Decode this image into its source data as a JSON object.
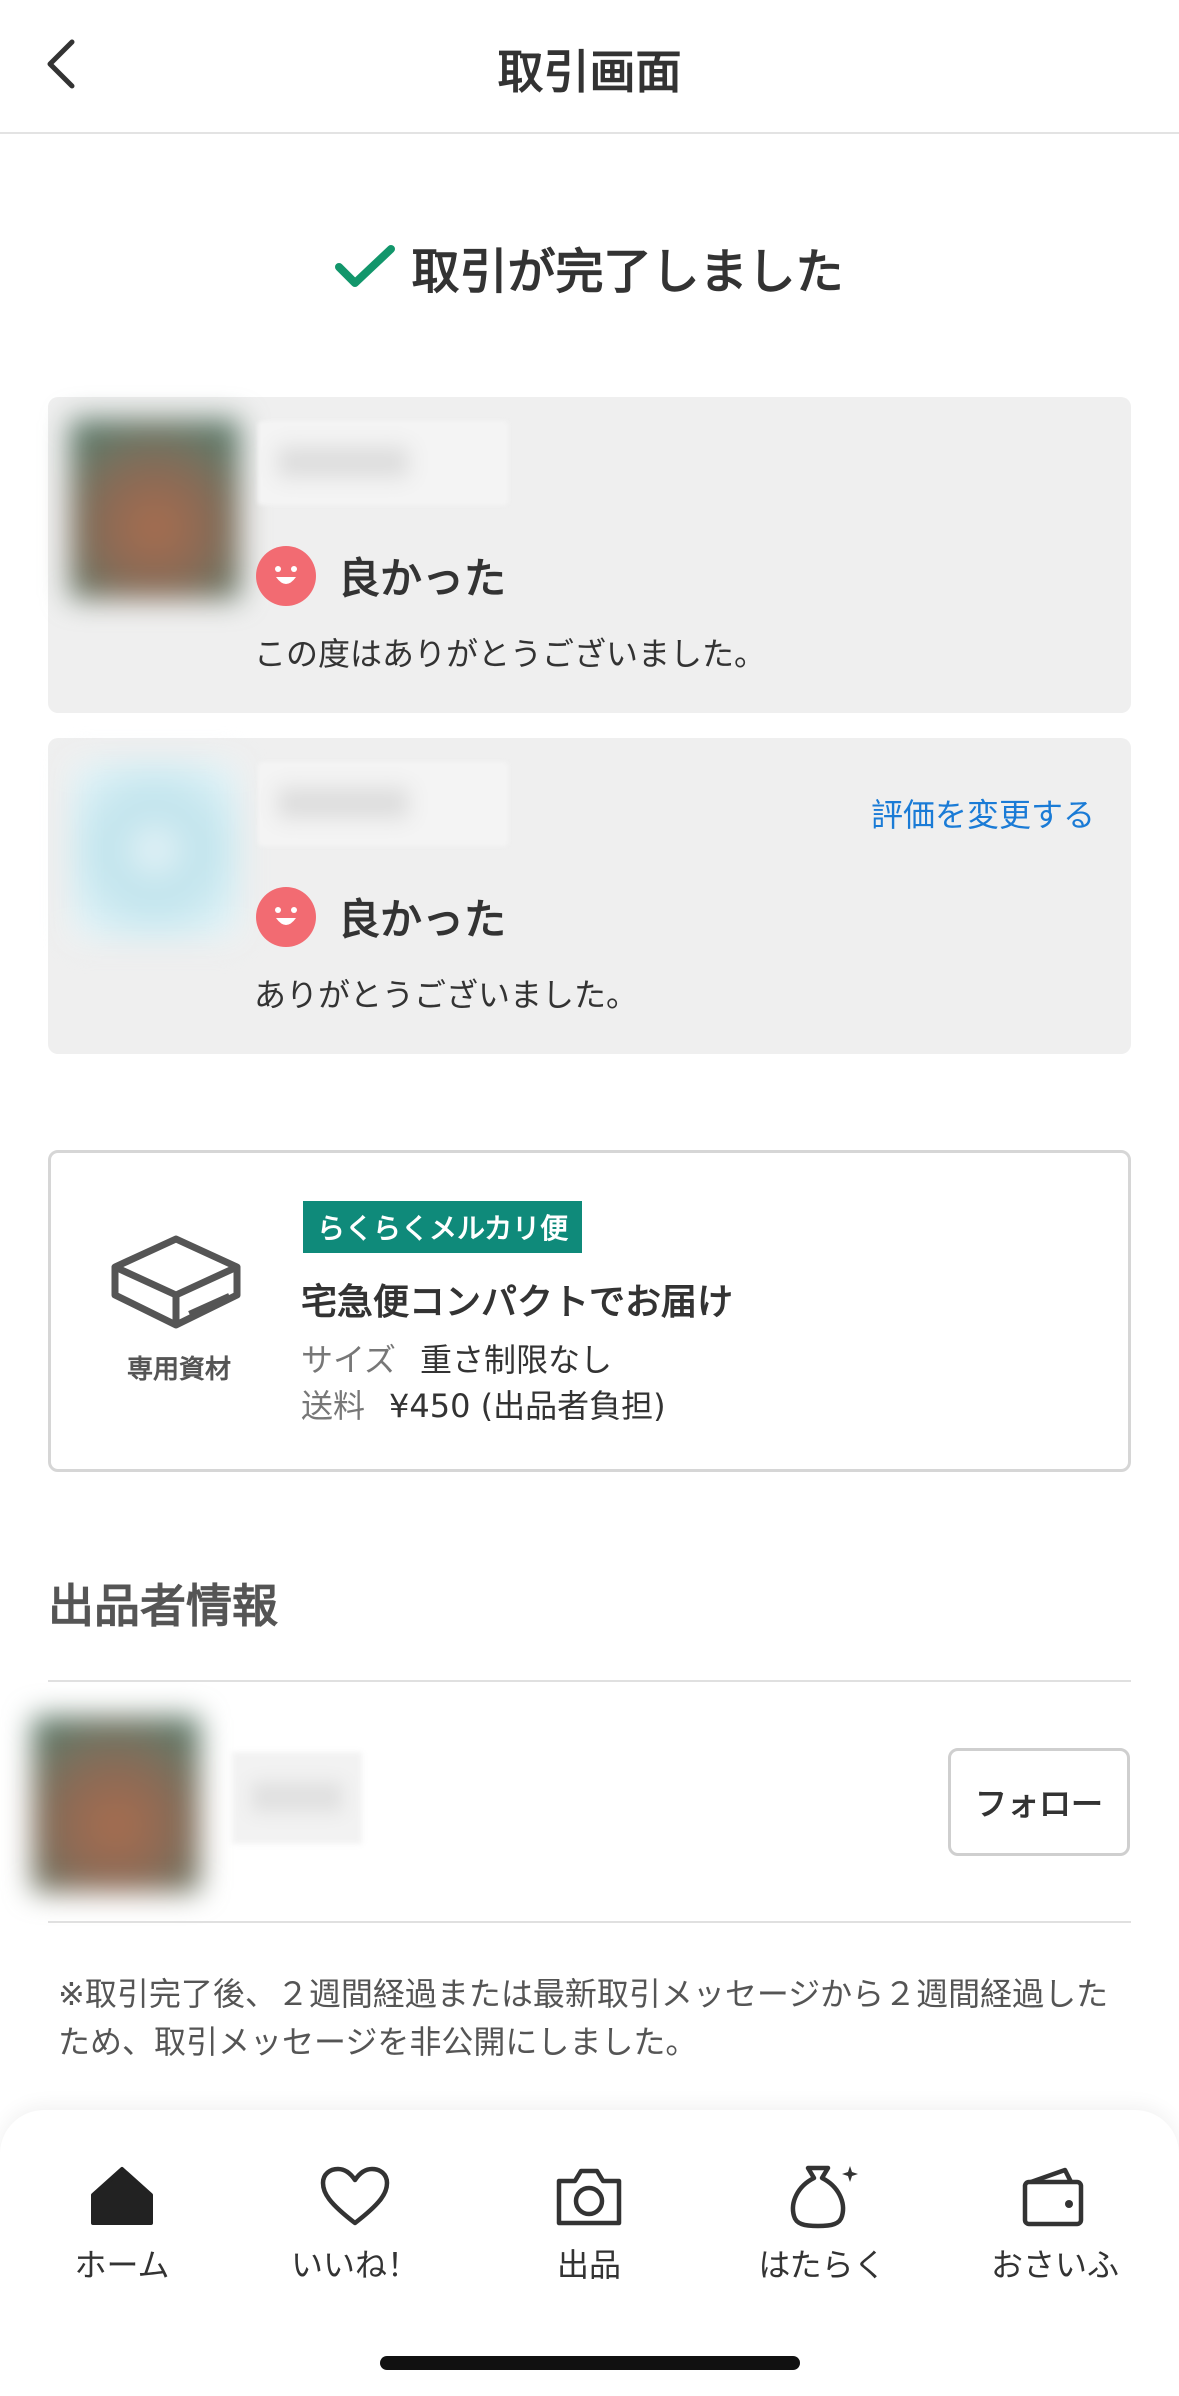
{
  "header": {
    "title": "取引画面"
  },
  "status": {
    "completed_text": "取引が完了しました"
  },
  "reviews": [
    {
      "rating_label": "良かった",
      "comment": "この度はありがとうございました。"
    },
    {
      "rating_label": "良かった",
      "comment": "ありがとうございました。",
      "change_link": "評価を変更する"
    }
  ],
  "shipping": {
    "box_label": "専用資材",
    "badge": "らくらくメルカリ便",
    "method": "宅急便コンパクトでお届け",
    "size_key": "サイズ",
    "size_value": "重さ制限なし",
    "fee_key": "送料",
    "fee_value": "¥450 (出品者負担)"
  },
  "seller": {
    "section_title": "出品者情報",
    "follow_label": "フォロー"
  },
  "notice": "※取引完了後、２週間経過または最新取引メッセージから２週間経過したため、取引メッセージを非公開にしました。",
  "nav": {
    "items": [
      {
        "label": "ホーム",
        "icon": "home-icon"
      },
      {
        "label": "いいね！",
        "icon": "heart-icon"
      },
      {
        "label": "出品",
        "icon": "camera-icon"
      },
      {
        "label": "はたらく",
        "icon": "money-bag-icon"
      },
      {
        "label": "おさいふ",
        "icon": "wallet-icon"
      }
    ]
  },
  "colors": {
    "check": "#12966b",
    "smile": "#f26b72",
    "link": "#1a7bd6",
    "badge": "#0f8a7a"
  }
}
